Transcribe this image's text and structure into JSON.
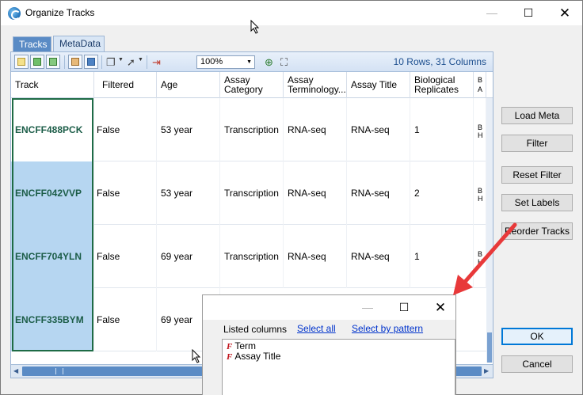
{
  "window": {
    "title": "Organize Tracks",
    "close_glyph": "✕",
    "max_glyph": "☐",
    "min_glyph": "—"
  },
  "tabs": [
    {
      "label": "Tracks",
      "active": false
    },
    {
      "label": "MetaData",
      "active": true
    }
  ],
  "toolbar": {
    "zoom_value": "100%",
    "row_info": "10 Rows, 31 Columns",
    "icons": [
      "new-file-icon",
      "export-excel-icon",
      "import-excel-icon",
      "print-icon",
      "grid-layout-icon",
      "copy-icon",
      "pointer-icon",
      "clear-filter-icon",
      "zoom-in-icon",
      "fit-columns-icon"
    ]
  },
  "columns": [
    {
      "label": "Track"
    },
    {
      "label": "Filtered"
    },
    {
      "label": "Age"
    },
    {
      "label": "Assay Category"
    },
    {
      "label": "Assay Terminology..."
    },
    {
      "label": "Assay  Title"
    },
    {
      "label": "Biological Replicates"
    },
    {
      "label": "B A"
    }
  ],
  "rows": [
    {
      "track": "ENCFF488PCK",
      "filtered": "False",
      "age": "53 year",
      "assay_category": "Transcription",
      "assay_terminology": "RNA-seq",
      "assay_title": "RNA-seq",
      "bio_replicates": "1",
      "edge": "B H"
    },
    {
      "track": "ENCFF042VVP",
      "filtered": "False",
      "age": "53 year",
      "assay_category": "Transcription",
      "assay_terminology": "RNA-seq",
      "assay_title": "RNA-seq",
      "bio_replicates": "2",
      "edge": "B H"
    },
    {
      "track": "ENCFF704YLN",
      "filtered": "False",
      "age": "69 year",
      "assay_category": "Transcription",
      "assay_terminology": "RNA-seq",
      "assay_title": "RNA-seq",
      "bio_replicates": "1",
      "edge": "B H"
    },
    {
      "track": "ENCFF335BYM",
      "filtered": "False",
      "age": "69 year",
      "assay_category": "",
      "assay_terminology": "",
      "assay_title": "",
      "bio_replicates": "",
      "edge": ""
    }
  ],
  "side_buttons": {
    "load_meta": "Load Meta",
    "filter": "Filter",
    "reset_filter": "Reset Filter",
    "set_labels": "Set Labels",
    "reorder_tracks": "Reorder Tracks",
    "ok": "OK",
    "cancel": "Cancel"
  },
  "popup": {
    "listed_label": "Listed columns",
    "select_all": "Select all",
    "select_by_pattern": "Select by pattern",
    "items": [
      {
        "marker": "F",
        "label": "Term"
      },
      {
        "marker": "F",
        "label": "Assay Title"
      }
    ]
  },
  "colors": {
    "accent": "#5a8bc5",
    "track_text": "#1c5d48",
    "selection": "#b6d6f1",
    "annotation_arrow": "#e8393a",
    "link": "#0033cc"
  }
}
